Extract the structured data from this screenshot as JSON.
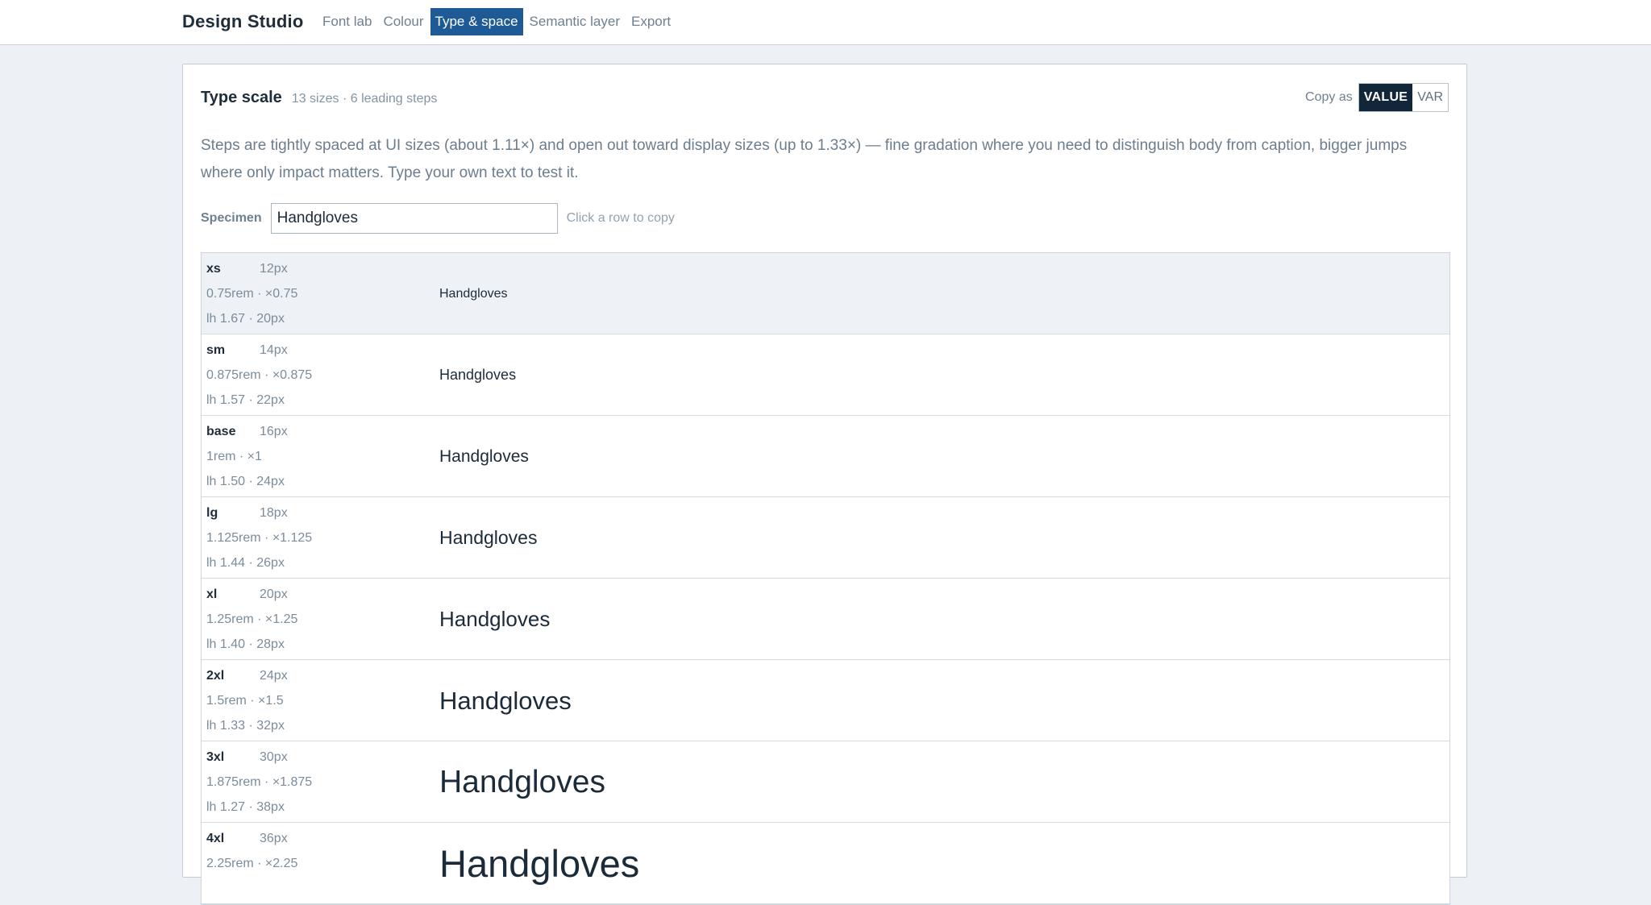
{
  "app": {
    "name": "Design Studio",
    "nav": [
      {
        "label": "Font lab",
        "active": false
      },
      {
        "label": "Colour",
        "active": false
      },
      {
        "label": "Type & space",
        "active": true
      },
      {
        "label": "Semantic layer",
        "active": false
      },
      {
        "label": "Export",
        "active": false
      }
    ]
  },
  "panel": {
    "title": "Type scale",
    "meta": "13 sizes · 6 leading steps",
    "copy_as_label": "Copy as",
    "copy_options": [
      {
        "label": "VALUE",
        "active": true
      },
      {
        "label": "VAR",
        "active": false
      }
    ],
    "description": "Steps are tightly spaced at UI sizes (about 1.11×) and open out toward display sizes (up to 1.33×) — fine gradation where you need to distinguish body from caption, bigger jumps where only impact matters. Type your own text to test it.",
    "specimen_label": "Specimen",
    "specimen_value": "Handgloves",
    "hint": "Click a row to copy"
  },
  "scale": [
    {
      "token": "xs",
      "px": "12px",
      "rem": "0.75rem · ×0.75",
      "lh": "lh 1.67 · 20px",
      "size": 12,
      "sample": "Handgloves",
      "highlighted": true
    },
    {
      "token": "sm",
      "px": "14px",
      "rem": "0.875rem · ×0.875",
      "lh": "lh 1.57 · 22px",
      "size": 14,
      "sample": "Handgloves",
      "highlighted": false
    },
    {
      "token": "base",
      "px": "16px",
      "rem": "1rem · ×1",
      "lh": "lh 1.50 · 24px",
      "size": 16,
      "sample": "Handgloves",
      "highlighted": false
    },
    {
      "token": "lg",
      "px": "18px",
      "rem": "1.125rem · ×1.125",
      "lh": "lh 1.44 · 26px",
      "size": 18,
      "sample": "Handgloves",
      "highlighted": false
    },
    {
      "token": "xl",
      "px": "20px",
      "rem": "1.25rem · ×1.25",
      "lh": "lh 1.40 · 28px",
      "size": 20,
      "sample": "Handgloves",
      "highlighted": false
    },
    {
      "token": "2xl",
      "px": "24px",
      "rem": "1.5rem · ×1.5",
      "lh": "lh 1.33 · 32px",
      "size": 24,
      "sample": "Handgloves",
      "highlighted": false
    },
    {
      "token": "3xl",
      "px": "30px",
      "rem": "1.875rem · ×1.875",
      "lh": "lh 1.27 · 38px",
      "size": 30,
      "sample": "Handgloves",
      "highlighted": false
    },
    {
      "token": "4xl",
      "px": "36px",
      "rem": "2.25rem · ×2.25",
      "lh": "",
      "size": 36,
      "sample": "Handgloves",
      "highlighted": false
    }
  ],
  "colors": {
    "accent": "#1d5a96",
    "dark": "#12263a",
    "background": "#edf1f5"
  }
}
